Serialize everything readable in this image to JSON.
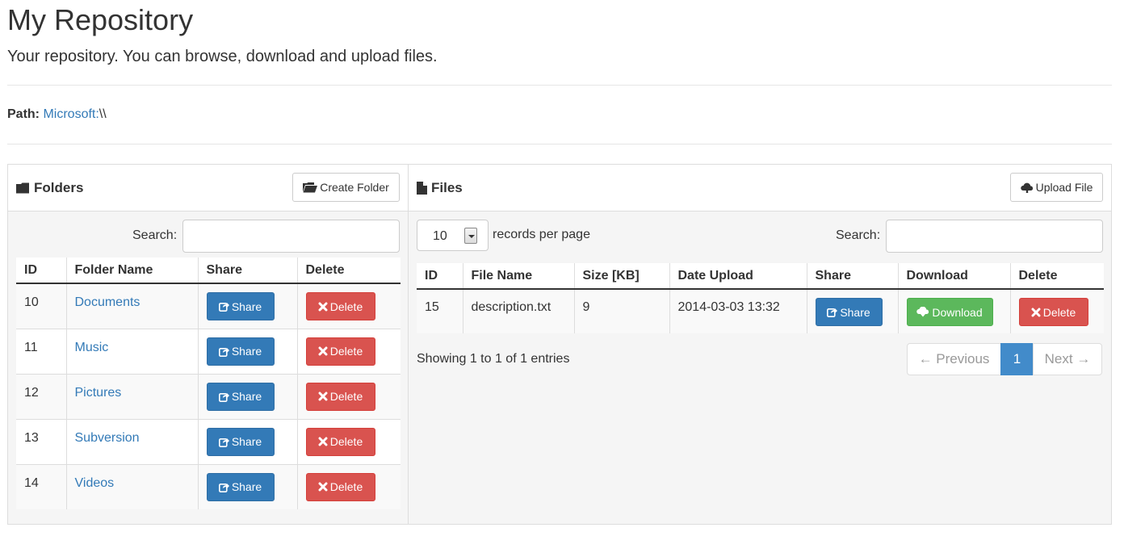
{
  "page": {
    "title": "My Repository",
    "lead": "Your repository. You can browse, download and upload files."
  },
  "path": {
    "label": "Path:",
    "link": "Microsoft:",
    "suffix": "\\\\"
  },
  "folders": {
    "title": "Folders",
    "create_label": "Create Folder",
    "search_label": "Search:",
    "search_value": "",
    "columns": [
      "ID",
      "Folder Name",
      "Share",
      "Delete"
    ],
    "rows": [
      {
        "id": "10",
        "name": "Documents",
        "share": "Share",
        "delete": "Delete"
      },
      {
        "id": "11",
        "name": "Music",
        "share": "Share",
        "delete": "Delete"
      },
      {
        "id": "12",
        "name": "Pictures",
        "share": "Share",
        "delete": "Delete"
      },
      {
        "id": "13",
        "name": "Subversion",
        "share": "Share",
        "delete": "Delete"
      },
      {
        "id": "14",
        "name": "Videos",
        "share": "Share",
        "delete": "Delete"
      }
    ]
  },
  "files": {
    "title": "Files",
    "upload_label": "Upload File",
    "page_size": "10",
    "page_size_label": "records per page",
    "search_label": "Search:",
    "search_value": "",
    "columns": [
      "ID",
      "File Name",
      "Size [KB]",
      "Date Upload",
      "Share",
      "Download",
      "Delete"
    ],
    "rows": [
      {
        "id": "15",
        "name": "description.txt",
        "size": "9",
        "date": "2014-03-03 13:32",
        "share": "Share",
        "download": "Download",
        "delete": "Delete"
      }
    ],
    "info": "Showing 1 to 1 of 1 entries",
    "pagination": {
      "prev": "← Previous",
      "current": "1",
      "next": "Next →"
    }
  },
  "colors": {
    "primary": "#337ab7",
    "danger": "#d9534f",
    "success": "#5cb85c",
    "active_page": "#428bca"
  },
  "icons": {
    "folders": "folder-icon",
    "files": "file-icon",
    "create": "folder-open-icon",
    "upload": "cloud-upload-icon",
    "share": "share-icon",
    "delete": "remove-icon",
    "download": "cloud-download-icon"
  }
}
